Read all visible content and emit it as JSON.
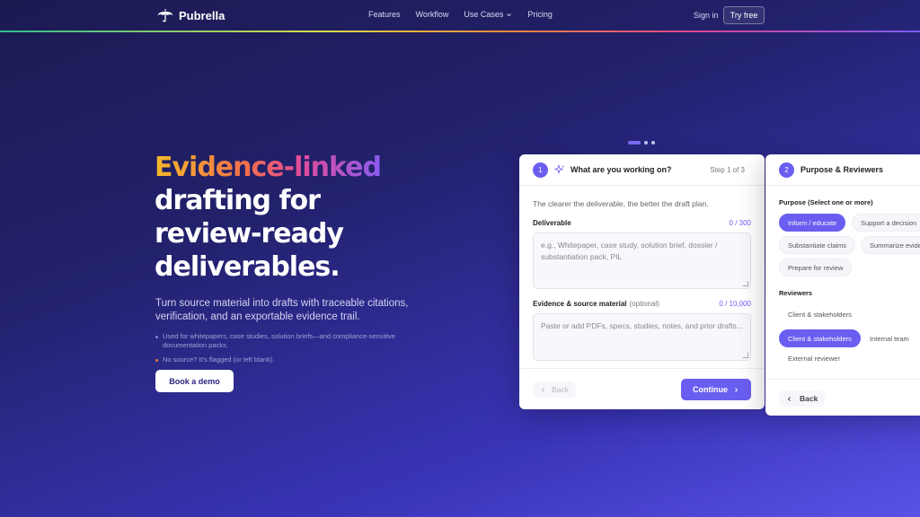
{
  "nav": {
    "brand": "Pubrella",
    "links": [
      "Features",
      "Workflow",
      "Use Cases",
      "Pricing"
    ],
    "use_cases_chevron": "chevron-down-icon",
    "sign_in": "Sign in",
    "try_free": "Try free"
  },
  "hero": {
    "title_highlight": "Evidence-linked",
    "title_line2": "drafting for",
    "title_line3": "review-ready",
    "title_line4": "deliverables.",
    "subtitle": "Turn source material into drafts with traceable citations, verification, and an exportable evidence trail.",
    "bullets": [
      {
        "text": "Used for whitepapers, case studies, solution briefs—and compliance-sensitive documentation packs.",
        "color": "#8b7cf5"
      },
      {
        "text": "No source? It's flagged (or left blank).",
        "color": "#f07a3c"
      }
    ],
    "cta": "Book a demo"
  },
  "step1": {
    "number": "1",
    "title": "What are you working on?",
    "step_label": "Step 1 of 3",
    "intro": "The clearer the deliverable, the better the draft plan.",
    "deliverable_label": "Deliverable",
    "deliverable_count": "0 / 300",
    "deliverable_placeholder": "e.g., Whitepaper, case study, solution brief, dossier / substantiation pack, PIL",
    "evidence_label": "Evidence & source material",
    "evidence_optional": "(optional)",
    "evidence_count": "0 / 10,000",
    "evidence_placeholder": "Paste or add PDFs, specs, studies, notes, and prior drafts...",
    "back": "Back",
    "continue": "Continue"
  },
  "step2": {
    "number": "2",
    "title": "Purpose & Reviewers",
    "purpose_label": "Purpose (Select one or more)",
    "purpose_chips": [
      {
        "label": "Inform / educate",
        "selected": true
      },
      {
        "label": "Support a decision",
        "selected": false
      },
      {
        "label": "Substantiate claims",
        "selected": false
      },
      {
        "label": "Summarize evidence",
        "selected": false
      },
      {
        "label": "Prepare for review",
        "selected": false
      }
    ],
    "reviewers_label": "Reviewers",
    "reviewer_chips": [
      {
        "label": "Client & stakeholders",
        "selected": false
      },
      {
        "label": "Client & stakeholders",
        "selected": true
      },
      {
        "label": "Internal team",
        "selected": false
      },
      {
        "label": "External reviewer",
        "selected": false
      }
    ],
    "back": "Back"
  },
  "colors": {
    "accent": "#6a5ef0",
    "bg_dark": "#1c1a52",
    "bg_light": "#5a52e6"
  }
}
